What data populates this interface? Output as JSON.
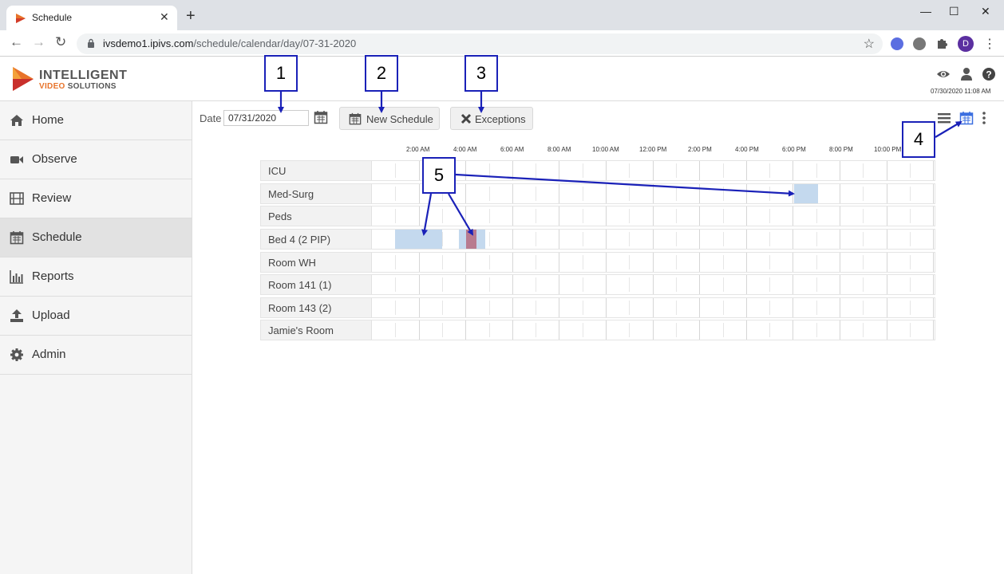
{
  "browser": {
    "tab_title": "Schedule",
    "new_tab_glyph": "+",
    "close_glyph": "✕",
    "url_host": "ivsdemo1.ipivs.com",
    "url_path": "/schedule/calendar/day/07-31-2020",
    "profile_initial": "D",
    "window_controls": [
      "—",
      "☐",
      "✕"
    ]
  },
  "header": {
    "logo_line1": "INTELLIGENT",
    "logo_line2a": "VIDEO",
    "logo_line2b": " SOLUTIONS",
    "datetime": "07/30/2020 11:08 AM",
    "icons": [
      "eye-icon",
      "user-icon",
      "help-icon"
    ]
  },
  "sidebar": {
    "items": [
      {
        "label": "Home",
        "icon": "home-icon"
      },
      {
        "label": "Observe",
        "icon": "camera-icon"
      },
      {
        "label": "Review",
        "icon": "film-icon"
      },
      {
        "label": "Schedule",
        "icon": "calendar-icon",
        "active": true
      },
      {
        "label": "Reports",
        "icon": "bar-chart-icon"
      },
      {
        "label": "Upload",
        "icon": "upload-icon"
      },
      {
        "label": "Admin",
        "icon": "gear-icon"
      }
    ]
  },
  "toolbar": {
    "date_label": "Date",
    "date_value": "07/31/2020",
    "new_schedule_label": "New Schedule",
    "exceptions_label": "Exceptions",
    "views": [
      "list-view-icon",
      "calendar-view-icon",
      "more-icon"
    ]
  },
  "calendar": {
    "time_labels": [
      "2:00 AM",
      "4:00 AM",
      "6:00 AM",
      "8:00 AM",
      "10:00 AM",
      "12:00 PM",
      "2:00 PM",
      "4:00 PM",
      "6:00 PM",
      "8:00 PM",
      "10:00 PM"
    ],
    "rooms": [
      "ICU",
      "Med-Surg",
      "Peds",
      "Bed 4 (2 PIP)",
      "Room WH",
      "Room 141 (1)",
      "Room 143 (2)",
      "Jamie's Room"
    ]
  },
  "annotations": {
    "labels": [
      "1",
      "2",
      "3",
      "4",
      "5"
    ]
  },
  "colors": {
    "schedule_block": "#c4d9ee",
    "exception_block": "#b87b8f",
    "annotation": "#1a21b8",
    "active_view": "#3b6fe0"
  }
}
